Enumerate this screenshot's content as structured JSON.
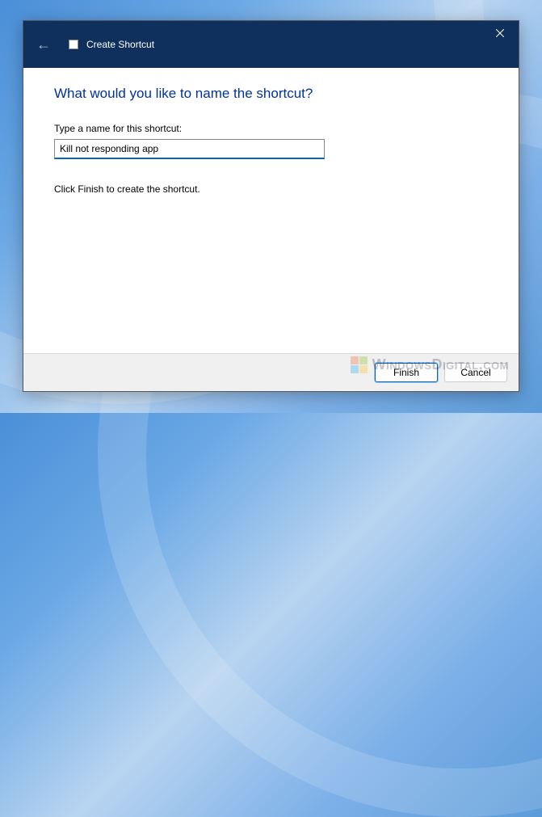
{
  "title_bar": {
    "title": "Create Shortcut"
  },
  "content": {
    "heading": "What would you like to name the shortcut?",
    "field_label": "Type a name for this shortcut:",
    "name_value": "Kill not responding app",
    "instruction": "Click Finish to create the shortcut."
  },
  "buttons": {
    "finish": "Finish",
    "cancel": "Cancel"
  },
  "watermark": {
    "text": "WindowsDigital.com"
  }
}
